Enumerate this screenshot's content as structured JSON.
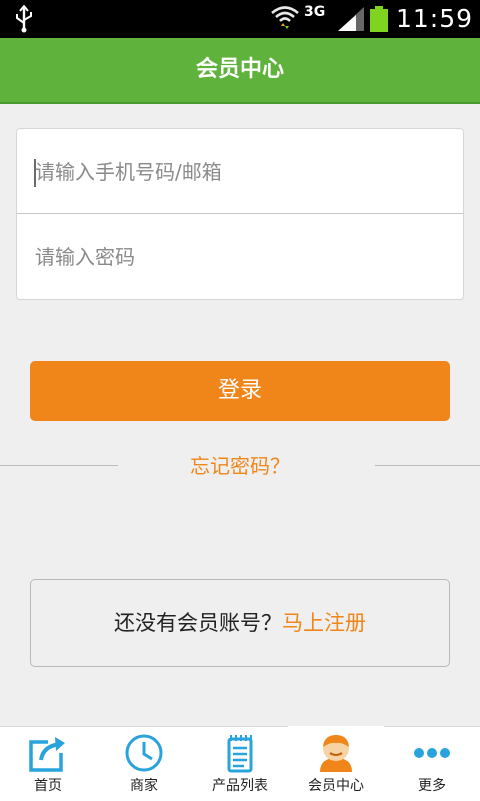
{
  "status_bar": {
    "network": "3G",
    "time": "11:59"
  },
  "header": {
    "title": "会员中心"
  },
  "login_form": {
    "phone_placeholder": "请输入手机号码/邮箱",
    "password_placeholder": "请输入密码",
    "submit_label": "登录"
  },
  "forgot_password": "忘记密码？",
  "register": {
    "prompt": "还没有会员账号？",
    "link": "马上注册"
  },
  "bottom_nav": {
    "items": [
      {
        "label": "首页",
        "icon": "share-icon"
      },
      {
        "label": "商家",
        "icon": "clock-icon"
      },
      {
        "label": "产品列表",
        "icon": "list-icon"
      },
      {
        "label": "会员中心",
        "icon": "user-icon"
      },
      {
        "label": "更多",
        "icon": "more-icon"
      }
    ],
    "active_index": 3
  },
  "colors": {
    "header_green": "#5fb23b",
    "accent_orange": "#f08619",
    "icon_blue": "#29a3dc"
  }
}
